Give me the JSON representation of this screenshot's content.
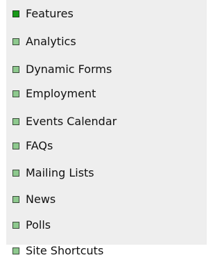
{
  "nav": {
    "items": [
      {
        "label": "Features",
        "icon": "square-bullet-icon",
        "active": true
      },
      {
        "label": "Analytics",
        "icon": "square-bullet-icon",
        "active": false
      },
      {
        "label": "Dynamic Forms",
        "icon": "square-bullet-icon",
        "active": false
      },
      {
        "label": "Employment",
        "icon": "square-bullet-icon",
        "active": false
      },
      {
        "label": "Events Calendar",
        "icon": "square-bullet-icon",
        "active": false
      },
      {
        "label": "FAQs",
        "icon": "square-bullet-icon",
        "active": false
      },
      {
        "label": "Mailing Lists",
        "icon": "square-bullet-icon",
        "active": false
      },
      {
        "label": "News",
        "icon": "square-bullet-icon",
        "active": false
      },
      {
        "label": "Polls",
        "icon": "square-bullet-icon",
        "active": false
      },
      {
        "label": "Site Shortcuts",
        "icon": "square-bullet-icon",
        "active": false
      }
    ]
  },
  "colors": {
    "panel_background": "#eeeeee",
    "bullet_active": "#189a18",
    "bullet_inactive": "#8ec98e",
    "text": "#111111"
  }
}
